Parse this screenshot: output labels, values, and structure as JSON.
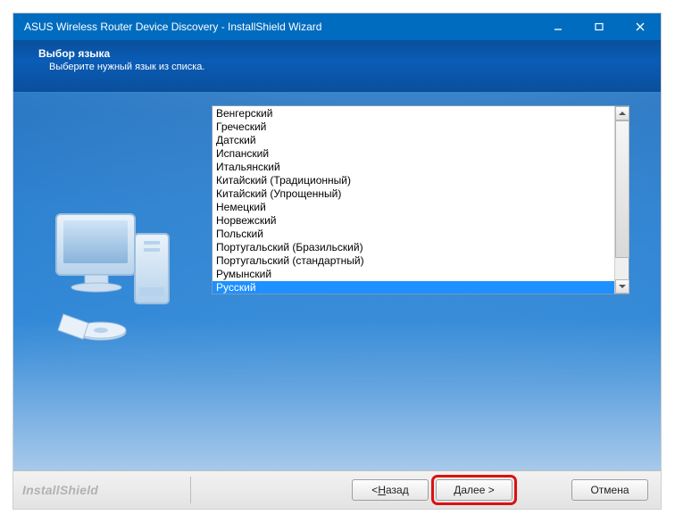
{
  "window": {
    "title": "ASUS Wireless Router Device Discovery - InstallShield Wizard"
  },
  "header": {
    "title": "Выбор языка",
    "subtitle": "Выберите нужный язык из списка."
  },
  "languages": [
    "Венгерский",
    "Греческий",
    "Датский",
    "Испанский",
    "Итальянский",
    "Китайский (Традиционный)",
    "Китайский (Упрощенный)",
    "Немецкий",
    "Норвежский",
    "Польский",
    "Португальский (Бразильский)",
    "Португальский (стандартный)",
    "Румынский",
    "Русский"
  ],
  "selected_index": 13,
  "footer": {
    "brand": "InstallShield",
    "back_prefix": "< ",
    "back_ul": "Н",
    "back_rest": "азад",
    "next_ul": "Д",
    "next_rest": "алее >",
    "cancel": "Отмена"
  }
}
